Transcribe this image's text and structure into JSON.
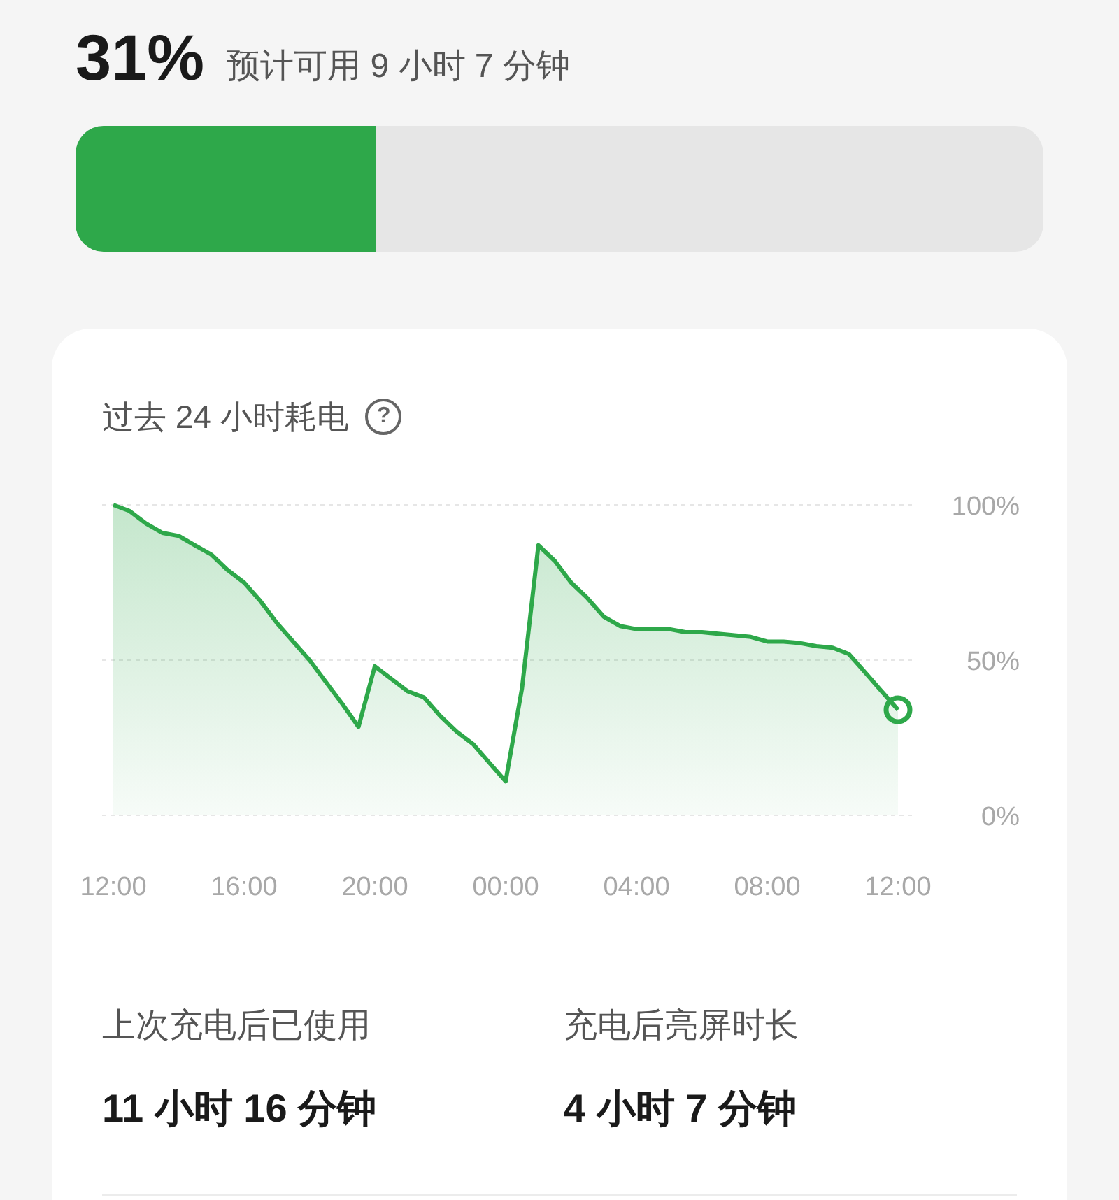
{
  "battery": {
    "percent": "31%",
    "estimate": "预计可用 9 小时 7 分钟",
    "level": 0.31
  },
  "usage_card": {
    "title": "过去 24 小时耗电",
    "help_icon": "?",
    "chart_data": {
      "type": "area",
      "categories": [
        "12:00",
        null,
        null,
        null,
        null,
        null,
        null,
        null,
        "16:00",
        null,
        null,
        null,
        null,
        null,
        null,
        null,
        "20:00",
        null,
        null,
        null,
        null,
        null,
        null,
        null,
        "00:00",
        null,
        null,
        null,
        null,
        null,
        null,
        null,
        "04:00",
        null,
        null,
        null,
        null,
        null,
        null,
        null,
        "08:00",
        null,
        null,
        null,
        null,
        null,
        null,
        null,
        "12:00"
      ],
      "series": [
        {
          "color": "#2ea84a",
          "values": [
            100,
            98,
            94,
            91,
            90,
            87,
            84,
            79,
            75,
            69,
            62,
            56,
            50,
            43,
            36,
            28.5,
            48,
            44,
            40,
            38,
            32,
            27,
            23,
            17,
            11,
            41,
            87,
            82,
            75,
            70,
            64,
            61,
            60,
            60,
            60,
            59,
            59,
            58.5,
            58,
            57.5,
            56,
            56,
            55.5,
            54.5,
            54,
            52,
            46,
            40,
            34
          ]
        }
      ],
      "ylim": [
        0,
        100
      ],
      "yticks": [
        {
          "value": 100,
          "label": "100%"
        },
        {
          "value": 50,
          "label": "50%"
        },
        {
          "value": 0,
          "label": "0%"
        }
      ]
    },
    "stats": [
      {
        "label": "上次充电后已使用",
        "value": "11 小时 16 分钟"
      },
      {
        "label": "充电后亮屏时长",
        "value": "4 小时 7 分钟"
      }
    ]
  }
}
